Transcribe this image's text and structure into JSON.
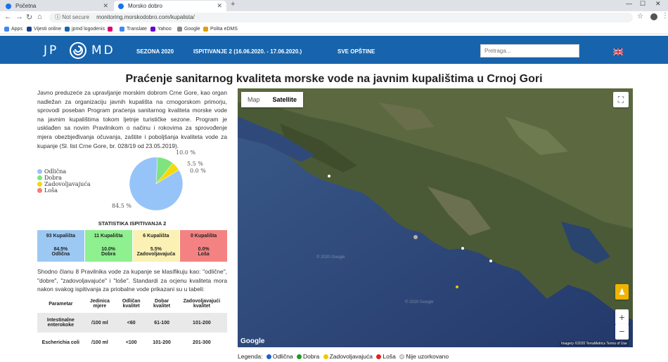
{
  "browser": {
    "tabs": [
      {
        "label": "Početna"
      },
      {
        "label": "Morsko dobro"
      }
    ],
    "not_secure": "Not secure",
    "url": "monitoring.morskodobro.com/kupalista/",
    "bookmarks": [
      {
        "label": "Apps",
        "color": "#4285f4"
      },
      {
        "label": "Vijesti online",
        "color": "#1a3d8f"
      },
      {
        "label": "jpmd logodenis",
        "color": "#1764ad"
      },
      {
        "label": "",
        "color": "#e20074"
      },
      {
        "label": "Translate",
        "color": "#4285f4"
      },
      {
        "label": "Yahoo",
        "color": "#6001d2"
      },
      {
        "label": "Google",
        "color": "#888888"
      },
      {
        "label": "Polita eDMS",
        "color": "#e0a000"
      }
    ]
  },
  "header": {
    "logo_left": "JP",
    "logo_right": "MD",
    "menu": [
      "SEZONA 2020",
      "ISPITIVANJE 2 (16.06.2020. - 17.06.2020.)",
      "SVE OPŠTINE"
    ],
    "search_placeholder": "Pretraga..."
  },
  "page": {
    "title": "Praćenje sanitarnog kvaliteta morske vode na javnim kupalištima u Crnoj Gori",
    "intro": "Javno preduzeće za upravljanje morskim dobrom Crne Gore, kao organ nadležan za organizaciju javnih kupališta na crnogorskom primorju, sprovodi poseban Program praćenja sanitarnog kvaliteta morske vode na javnim kupalištima tokom ljetnje turističke sezone. Program je usklađen sa novim Pravilnikom o načinu i rokovima za sprovođenje mjera obezbjeđivanja očuvanja, zaštite i poboljšanja kvaliteta vode za kupanje (Sl. list Crne Gore, br. 028/19 od 23.05.2019).",
    "para2": "Shodno članu 8 Pravilnika vode za kupanje se klasifikuju kao: \"odlične\", \"dobre\", \"zadovoljavajuće\" i \"loše\". Standardi za ocjenu kvaliteta mora nakon svakog ispitivanja za priobalne vode prikazani su u tabeli:"
  },
  "chart_data": {
    "type": "pie",
    "categories": [
      "Odlična",
      "Dobra",
      "Zadovoljavajuća",
      "Loša"
    ],
    "values": [
      84.5,
      10.0,
      5.5,
      0.0
    ],
    "labels": [
      "84.5 %",
      "10.0 %",
      "5.5 %",
      "0.0 %"
    ],
    "colors": [
      "#97c4f8",
      "#7fe37f",
      "#f5d90a",
      "#f47c7c"
    ],
    "legend": "left"
  },
  "stats": {
    "heading": "STATISTIKA ISPITIVANJA 2",
    "cells": [
      {
        "count": "93 Kupališta",
        "pct": "84.5%",
        "label": "Odlična",
        "bg": "#9cc9f3"
      },
      {
        "count": "11 Kupališta",
        "pct": "10.0%",
        "label": "Dobra",
        "bg": "#8ef08e"
      },
      {
        "count": "6 Kupališta",
        "pct": "5.5%",
        "label": "Zadovoljavajuća",
        "bg": "#fbf1b4"
      },
      {
        "count": "0 Kupališta",
        "pct": "0.0%",
        "label": "Loša",
        "bg": "#f48282"
      }
    ]
  },
  "params_table": {
    "headers": [
      "Parametar",
      "Jedinica mjere",
      "Odličan kvalitet",
      "Dobar kvalitet",
      "Zadovoljavajući kvalitet"
    ],
    "rows": [
      [
        "Intestinalne enterokoke",
        "/100 ml",
        "<60",
        "61-100",
        "101-200"
      ],
      [
        "Escherichia coli",
        "/100 ml",
        "<100",
        "101-200",
        "201-300"
      ]
    ]
  },
  "map": {
    "type_map": "Map",
    "type_satellite": "Satellite",
    "google": "Google",
    "attribution": "Imagery ©2020 TerraMetrics   Terms of Use",
    "watermark": "© 2020 Google"
  },
  "map_legend": {
    "prefix": "Legenda:",
    "items": [
      {
        "label": "Odlična",
        "color": "#1f5fd1"
      },
      {
        "label": "Dobra",
        "color": "#1f9a1f"
      },
      {
        "label": "Zadovoljavajuća",
        "color": "#f0c800"
      },
      {
        "label": "Loša",
        "color": "#d22"
      },
      {
        "label": "Nije uzorkovano",
        "color": "#ddd"
      }
    ]
  }
}
